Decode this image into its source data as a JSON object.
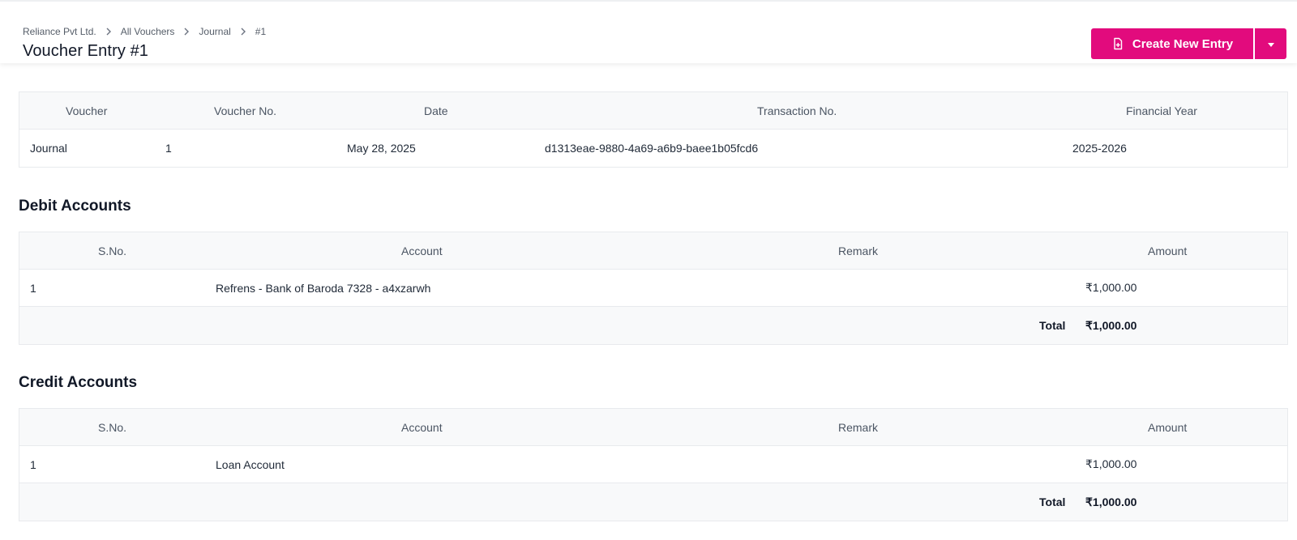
{
  "breadcrumb": {
    "company": "Reliance Pvt Ltd.",
    "all_vouchers": "All Vouchers",
    "journal": "Journal",
    "current": "#1"
  },
  "page_title": "Voucher Entry #1",
  "actions": {
    "create_label": "Create New Entry",
    "accent_color": "#e20b7d"
  },
  "voucher_table": {
    "headers": {
      "voucher": "Voucher",
      "voucher_no": "Voucher No.",
      "date": "Date",
      "transaction_no": "Transaction No.",
      "financial_year": "Financial Year"
    },
    "row": {
      "voucher": "Journal",
      "voucher_no": "1",
      "date": "May 28, 2025",
      "transaction_no": "d1313eae-9880-4a69-a6b9-baee1b05fcd6",
      "financial_year": "2025-2026"
    }
  },
  "debit": {
    "title": "Debit Accounts",
    "headers": {
      "sno": "S.No.",
      "account": "Account",
      "remark": "Remark",
      "amount": "Amount"
    },
    "rows": [
      {
        "sno": "1",
        "account": "Refrens - Bank of Baroda 7328 - a4xzarwh",
        "remark": "",
        "amount": "₹1,000.00"
      }
    ],
    "total_label": "Total",
    "total_amount": "₹1,000.00"
  },
  "credit": {
    "title": "Credit Accounts",
    "headers": {
      "sno": "S.No.",
      "account": "Account",
      "remark": "Remark",
      "amount": "Amount"
    },
    "rows": [
      {
        "sno": "1",
        "account": "Loan Account",
        "remark": "",
        "amount": "₹1,000.00"
      }
    ],
    "total_label": "Total",
    "total_amount": "₹1,000.00"
  }
}
